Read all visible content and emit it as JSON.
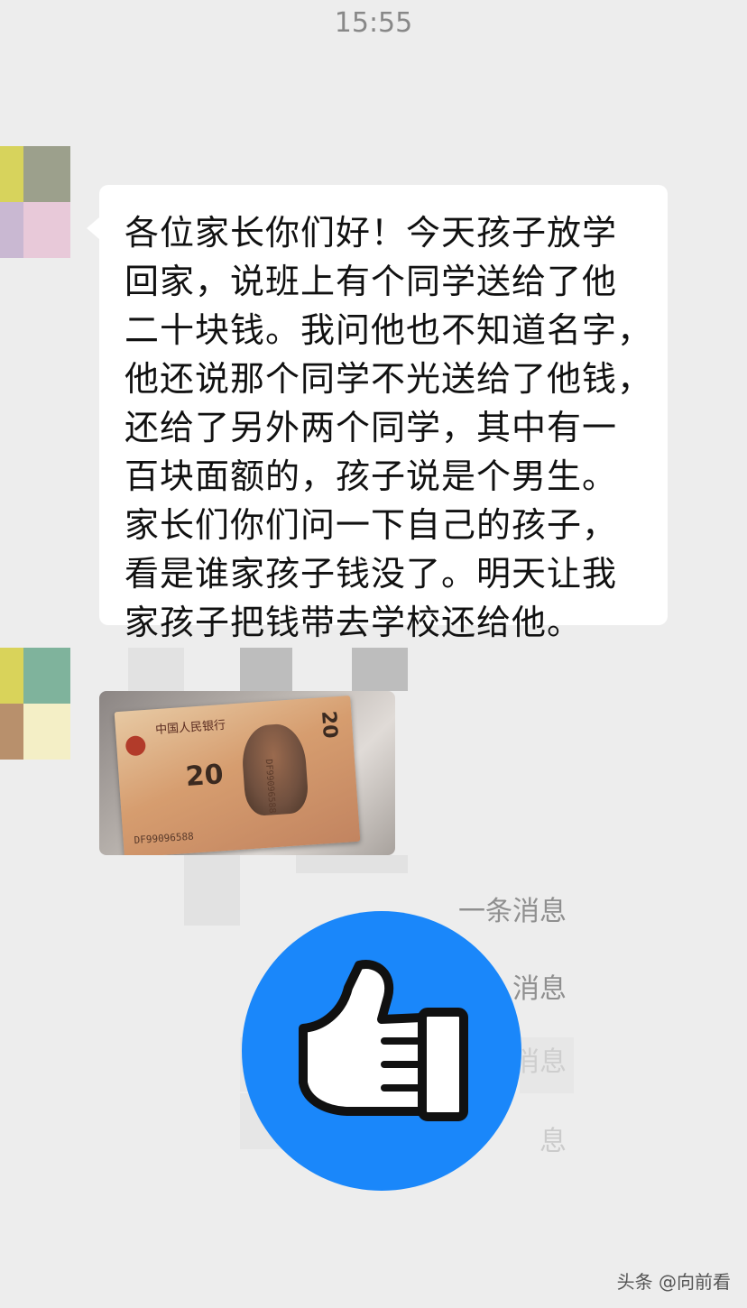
{
  "status": {
    "time": "15:55"
  },
  "chat": {
    "message_lines": [
      "各位家长你们好！今天孩子放学",
      "回家，说班上有个同学送给了他",
      "二十块钱。我问他也不知道名字，",
      "他还说那个同学不光送给了他钱，",
      "还给了另外两个同学，其中有一",
      "百块面额的，孩子说是个男生。",
      "家长们你们问一下自己的孩子，",
      "看是谁家孩子钱没了。明天让我",
      "家孩子把钱带去学校还给他。"
    ],
    "photo": {
      "bank_text": "中国人民银行",
      "value": "20",
      "serial": "DF99096588"
    },
    "system_lines": [
      "一条消息",
      "消息",
      "消息",
      "息"
    ]
  },
  "overlay": {
    "icon": "thumbs-up-icon",
    "color": "#1a87fa"
  },
  "watermark": "头条 @向前看"
}
